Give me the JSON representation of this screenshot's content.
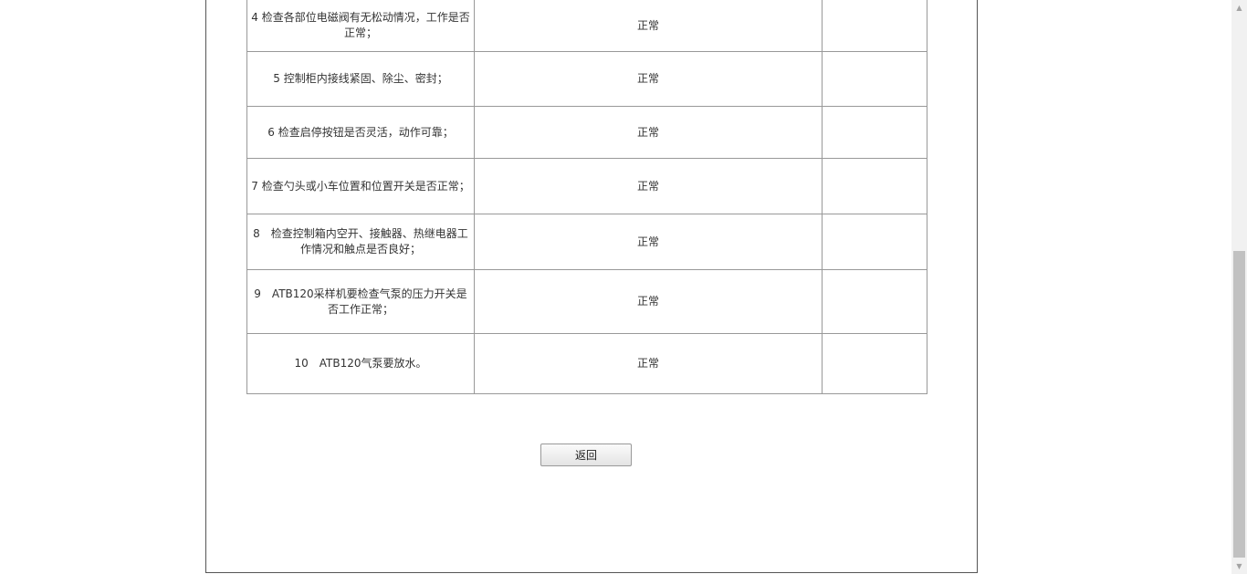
{
  "rows": [
    {
      "item": "4 检查各部位电磁阀有无松动情况，工作是否正常；",
      "status": "正常",
      "remark": ""
    },
    {
      "item": "5 控制柜内接线紧固、除尘、密封；",
      "status": "正常",
      "remark": ""
    },
    {
      "item": "6 检查启停按钮是否灵活，动作可靠；",
      "status": "正常",
      "remark": ""
    },
    {
      "item": "7 检查勺头或小车位置和位置开关是否正常；",
      "status": "正常",
      "remark": ""
    },
    {
      "item": "8　检查控制箱内空开、接触器、热继电器工作情况和触点是否良好；",
      "status": "正常",
      "remark": ""
    },
    {
      "item": "9　ATB120采样机要检查气泵的压力开关是否工作正常；",
      "status": "正常",
      "remark": ""
    },
    {
      "item": "10　ATB120气泵要放水。",
      "status": "正常",
      "remark": ""
    }
  ],
  "back_button_label": "返回",
  "icons": {
    "scroll_up": "scroll-up-arrow-icon",
    "scroll_down": "scroll-down-arrow-icon"
  }
}
